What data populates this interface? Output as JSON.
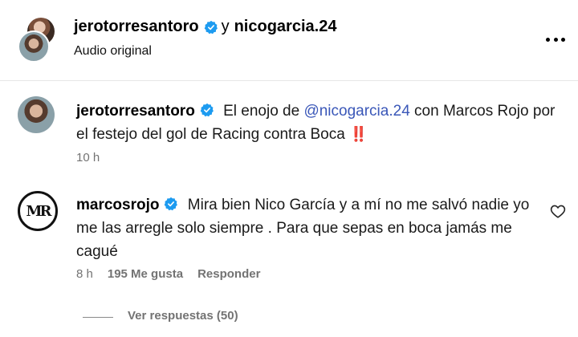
{
  "header": {
    "user1": "jerotorresantoro",
    "conjunction": "y",
    "user2": "nicogarcia.24",
    "audio_label": "Audio original",
    "more_icon": "more-horizontal-icon"
  },
  "caption": {
    "username": "jerotorresantoro",
    "text_part1": "El enojo de ",
    "mention": "@nicogarcia.24",
    "text_part2": " con Marcos Rojo por el festejo del gol de Racing contra Boca",
    "emoji": "‼️",
    "time": "10 h"
  },
  "comment": {
    "username": "marcosrojo",
    "avatar_logo": "MR",
    "text": "Mira bien Nico García y a mí no me salvó nadie yo me las arregle solo siempre . Para que sepas en boca jamás me cagué",
    "time": "8 h",
    "likes": "195 Me gusta",
    "reply_label": "Responder",
    "view_replies": "Ver respuestas (50)"
  },
  "colors": {
    "verified": "#1d9bf0",
    "mention": "#3a57b8",
    "secondary_text": "#737373"
  }
}
